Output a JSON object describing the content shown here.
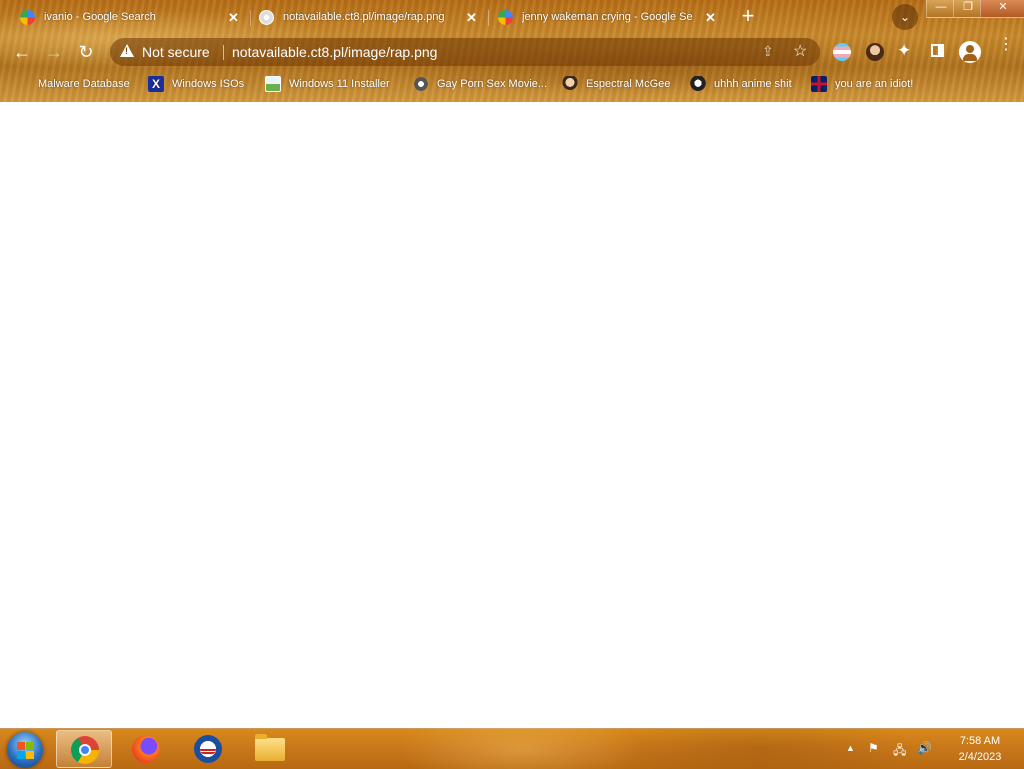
{
  "browser": {
    "tabs": [
      {
        "title": "ivanio - Google Search",
        "active": false
      },
      {
        "title": "notavailable.ct8.pl/image/rap.png",
        "active": true
      },
      {
        "title": "jenny wakeman crying - Google Se",
        "active": false
      }
    ],
    "window_controls": {
      "minimize": "—",
      "restore": "❐",
      "close": "✕"
    },
    "omnibox": {
      "security_label": "Not secure",
      "url": "notavailable.ct8.pl/image/rap.png"
    },
    "bookmarks": [
      {
        "label": "Malware Database",
        "icon": "folder-icon"
      },
      {
        "label": "Windows ISOs",
        "icon": "x-icon"
      },
      {
        "label": "Windows 11 Installer",
        "icon": "image-icon"
      },
      {
        "label": "Gay Porn Sex Movie...",
        "icon": "gear-icon"
      },
      {
        "label": "Espectral McGee",
        "icon": "character-icon"
      },
      {
        "label": "uhhh anime shit",
        "icon": "anime-icon"
      },
      {
        "label": "you are an idiot!",
        "icon": "flag-icon"
      }
    ]
  },
  "taskbar": {
    "apps": [
      "Google Chrome",
      "Firefox",
      "Opera",
      "File Explorer"
    ],
    "tray": {
      "arrow": "▲",
      "flag": "⚑",
      "network": "🖧",
      "volume": "🔊"
    },
    "time": "7:58 AM",
    "date": "2/4/2023"
  },
  "colors": {
    "accent": "#c8761a",
    "chrome_bg": "#b86e16"
  }
}
